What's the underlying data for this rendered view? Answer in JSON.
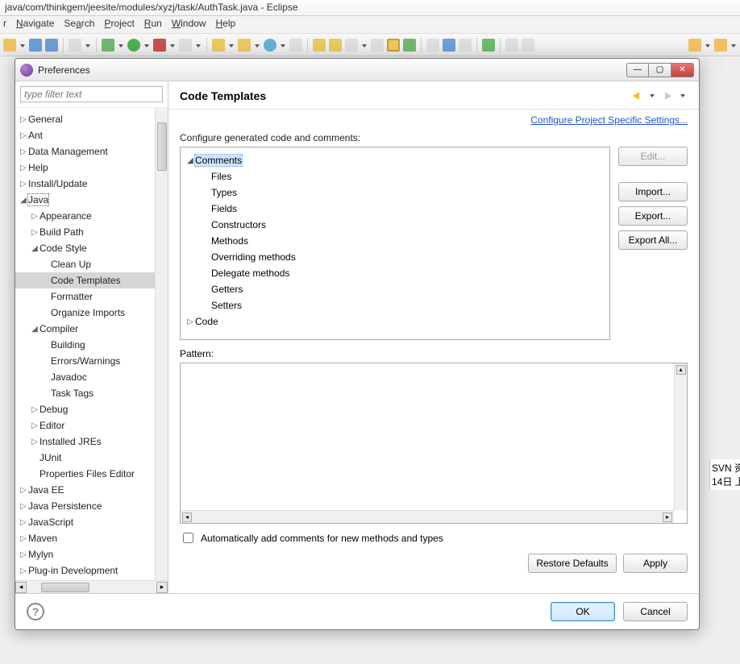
{
  "window_title": "java/com/thinkgem/jeesite/modules/xyzj/task/AuthTask.java - Eclipse",
  "menus": {
    "r1": "r",
    "navigate": "Navigate",
    "search": "Search",
    "project": "Project",
    "run": "Run",
    "window": "Window",
    "help": "Help"
  },
  "dialog": {
    "title": "Preferences",
    "filter_placeholder": "type filter text",
    "tree": {
      "general": "General",
      "ant": "Ant",
      "data_management": "Data Management",
      "help": "Help",
      "install_update": "Install/Update",
      "java": "Java",
      "appearance": "Appearance",
      "build_path": "Build Path",
      "code_style": "Code Style",
      "clean_up": "Clean Up",
      "code_templates": "Code Templates",
      "formatter": "Formatter",
      "organize_imports": "Organize Imports",
      "compiler": "Compiler",
      "building": "Building",
      "errors_warnings": "Errors/Warnings",
      "javadoc": "Javadoc",
      "task_tags": "Task Tags",
      "debug": "Debug",
      "editor": "Editor",
      "installed_jres": "Installed JREs",
      "junit": "JUnit",
      "properties_files_ed": "Properties Files Editor",
      "java_ee": "Java EE",
      "java_persistence": "Java Persistence",
      "javascript": "JavaScript",
      "maven": "Maven",
      "mylyn": "Mylyn",
      "plugin_dev": "Plug-in Development"
    },
    "main": {
      "title": "Code Templates",
      "config_link": "Configure Project Specific Settings...",
      "section_label": "Configure generated code and comments:",
      "items": {
        "comments": "Comments",
        "files": "Files",
        "types": "Types",
        "fields": "Fields",
        "constructors": "Constructors",
        "methods": "Methods",
        "overriding": "Overriding methods",
        "delegate": "Delegate methods",
        "getters": "Getters",
        "setters": "Setters",
        "code": "Code"
      },
      "buttons": {
        "edit": "Edit...",
        "import": "Import...",
        "export": "Export...",
        "export_all": "Export All..."
      },
      "pattern_label": "Pattern:",
      "auto_comment": "Automatically add comments for new methods and types",
      "restore_defaults": "Restore Defaults",
      "apply": "Apply"
    },
    "footer": {
      "ok": "OK",
      "cancel": "Cancel"
    }
  },
  "right_panel": {
    "svn": "SVN 资",
    "date": "14日 上"
  }
}
